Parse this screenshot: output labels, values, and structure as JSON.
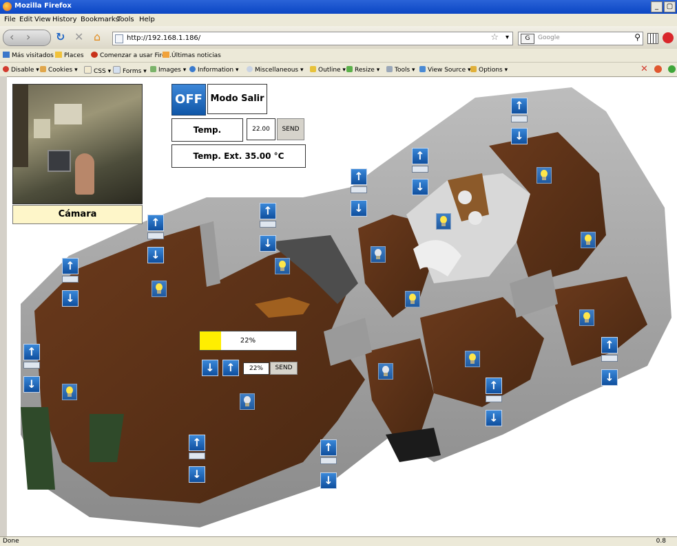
{
  "window": {
    "title": "Mozilla Firefox",
    "buttons": [
      "_",
      "▢"
    ]
  },
  "menu": [
    "File",
    "Edit",
    "View",
    "History",
    "Bookmarks",
    "Tools",
    "Help"
  ],
  "nav": {
    "url": "http://192.168.1.186/",
    "search_placeholder": "Google",
    "search_engine": "G"
  },
  "bookmarks": [
    "Más visitados",
    "Places",
    "Comenzar a usar Fire...",
    "Últimas noticias"
  ],
  "devtools": [
    "Disable",
    "Cookies",
    "CSS",
    "Forms",
    "Images",
    "Information",
    "Miscellaneous",
    "Outline",
    "Resize",
    "Tools",
    "View Source",
    "Options"
  ],
  "controls": {
    "off_label": "OFF",
    "mode_label": "Modo Salir",
    "temp_label": "Temp.",
    "temp_value": "22.00",
    "send_label": "SEND",
    "temp_ext_label": "Temp. Ext.  35.00 °C",
    "camera_label": "Cámara"
  },
  "dimmer": {
    "level_text": "22%",
    "level_fraction": 0.22,
    "input_value": "22%",
    "send_label": "SEND"
  },
  "arrows": {
    "up": "↑",
    "down": "↓"
  },
  "status": {
    "text": "Done",
    "right": "0.8"
  },
  "colors": {
    "accent_blue": "#1f5aa0",
    "progress_yellow": "#ffee00",
    "floor_wood": "#5b3219",
    "wall": "#a9a9a9"
  }
}
